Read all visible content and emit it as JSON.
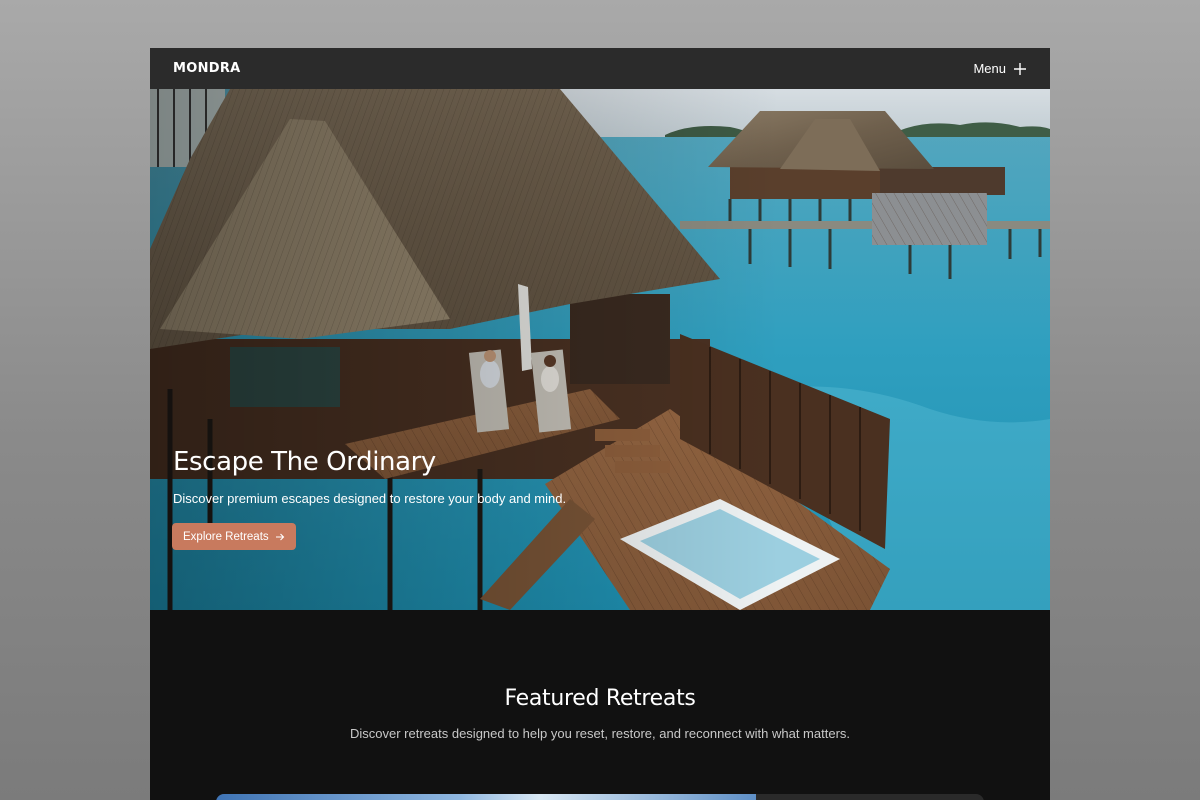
{
  "nav": {
    "logo": "MONDRA",
    "menu_label": "Menu",
    "menu_icon": "plus-icon"
  },
  "hero": {
    "title": "Escape The Ordinary",
    "subtitle": "Discover premium escapes designed to restore your body and mind.",
    "cta_label": "Explore Retreats",
    "cta_icon": "arrow-right-icon",
    "cta_color": "#c87a5e"
  },
  "featured": {
    "title": "Featured Retreats",
    "subtitle": "Discover retreats designed to help you reset, restore, and reconnect with what matters."
  },
  "colors": {
    "nav_bg": "#2b2b2b",
    "page_bg": "#111111",
    "accent": "#c87a5e"
  }
}
